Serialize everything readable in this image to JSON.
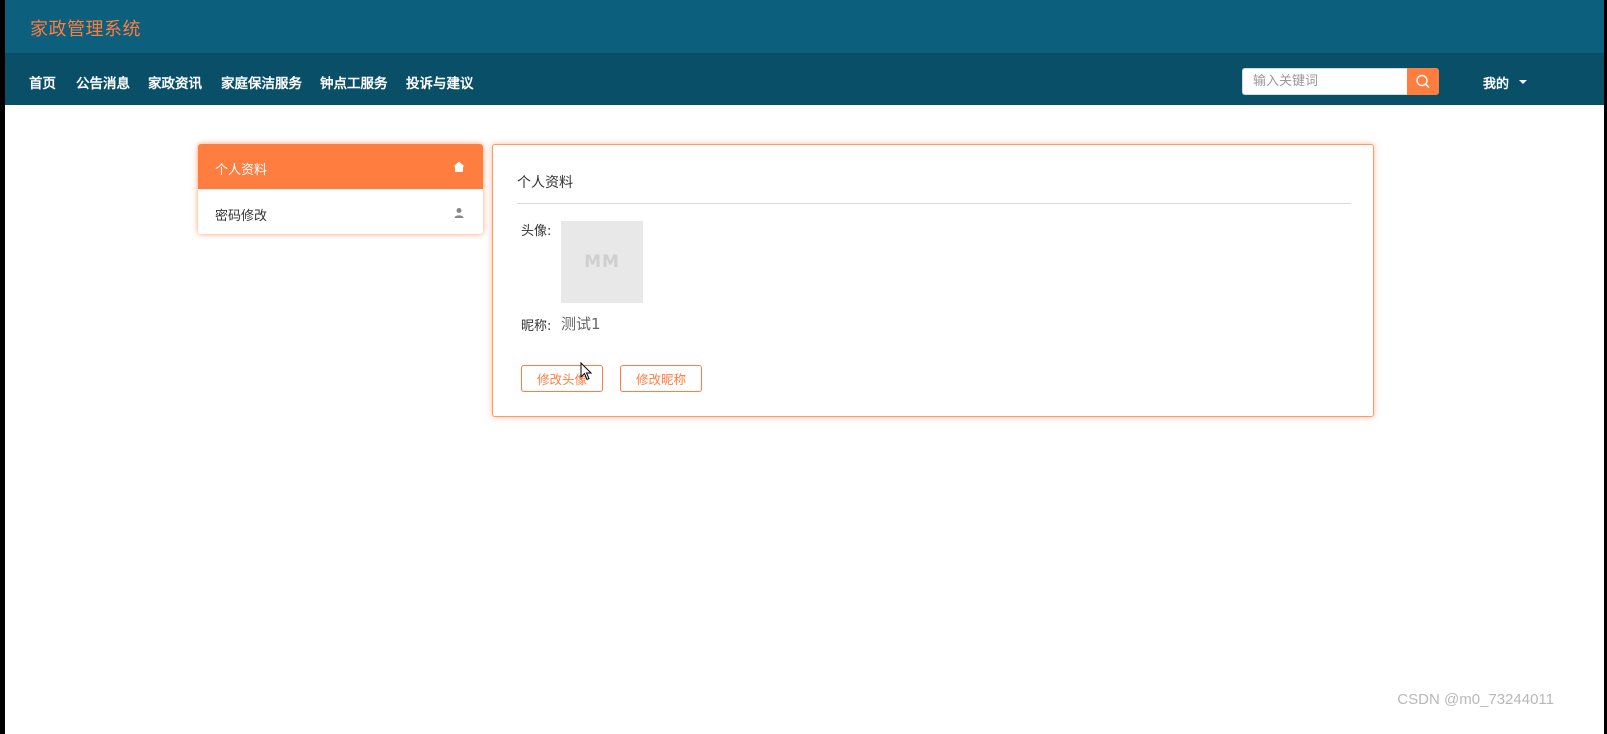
{
  "app": {
    "title": "家政管理系统"
  },
  "nav": {
    "items": [
      "首页",
      "公告消息",
      "家政资讯",
      "家庭保洁服务",
      "钟点工服务",
      "投诉与建议"
    ],
    "search_placeholder": "输入关键词",
    "mine_label": "我的"
  },
  "sidebar": {
    "items": [
      {
        "label": "个人资料",
        "icon": "home-icon",
        "active": true
      },
      {
        "label": "密码修改",
        "icon": "user-icon",
        "active": false
      }
    ]
  },
  "profile": {
    "title": "个人资料",
    "avatar_label": "头像:",
    "avatar_text": "MM",
    "nickname_label": "昵称:",
    "nickname_value": "测试1",
    "change_avatar_button": "修改头像",
    "change_nickname_button": "修改昵称"
  },
  "watermark": "CSDN @m0_73244011",
  "colors": {
    "accent": "#ff7d3f",
    "header_top": "#0c5f7d",
    "nav_bar": "#0a4f68"
  }
}
